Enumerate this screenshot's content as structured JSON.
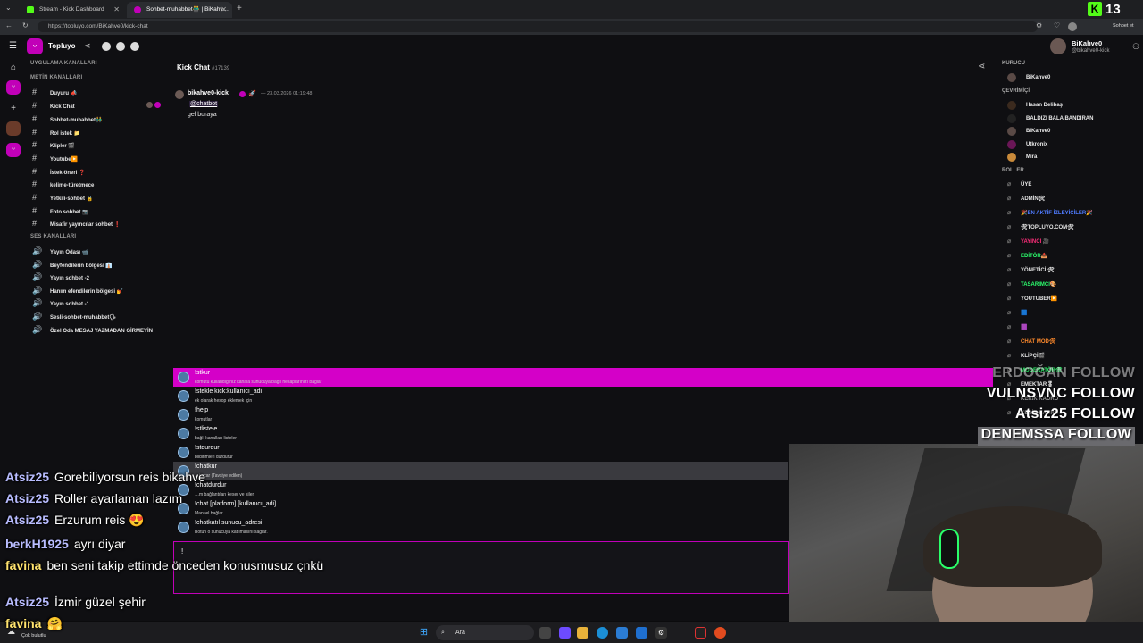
{
  "browser": {
    "tabs": [
      {
        "label": "Stream - Kick Dashboard",
        "active": false
      },
      {
        "label": "Sohbet-muhabbet👬 | BiKahv…",
        "active": true
      }
    ],
    "new_tab_glyph": "+",
    "url": "https://topluyo.com/BiKahve0/kick-chat",
    "kick_counter": "13",
    "sohbet_label": "Sohbet et"
  },
  "app": {
    "brand": "Topluyo",
    "sections": {
      "app_channels": "UYGULAMA KANALLARI",
      "text_channels": "METİN KANALLARI",
      "voice_channels": "SES KANALLARI"
    },
    "text_channels": [
      "Duyuru 📣",
      "Kick Chat",
      "Sohbet-muhabbet👬",
      "Rol istek 📁",
      "Klipler 🎬",
      "Youtube▶️",
      "İstek-öneri ❓",
      "kelime-türetmece",
      "Yetkili-sohbet 🔒",
      "Foto sohbet 📷",
      "Misafir yayıncılar sohbet ❗"
    ],
    "voice_channels": [
      "Yayın Odası 📹",
      "Beyfendilerin bölgesi 👔",
      "Yayın sohbet -2",
      "Hanım efendilerin bölgesi 💅",
      "Yayın sohbet -1",
      "Sesli-sohbet-muhabbet🗣",
      "Özel Oda MESAJ YAZMADAN GİRMEYİN"
    ]
  },
  "chat": {
    "title": "Kick Chat",
    "id": "#17139",
    "message": {
      "author": "bikahve0-kick",
      "time": "— 23.03.2026 01:19:48",
      "mention": "@chatbot",
      "text": "gel buraya"
    },
    "commands": [
      {
        "name": "!stkur",
        "desc": "komutu kullandığınız kanala sunucuya bağlı hesaplarınızı bağlar"
      },
      {
        "name": "!stekle kick:kullanıcı_adi",
        "desc": "ek olarak hesop eklemek için"
      },
      {
        "name": "!help",
        "desc": "komutlar"
      },
      {
        "name": "!stlistele",
        "desc": "bağlı kanalları listeler"
      },
      {
        "name": "!stdurdur",
        "desc": "bildirimleri durdurur"
      },
      {
        "name": "!chatkur",
        "desc": "…i açar (Tavsiye edilen)"
      },
      {
        "name": "!chatdurdur",
        "desc": "…m bağlantıları keser ve siler."
      },
      {
        "name": "!chat [platform] [kullanıcı_adi]",
        "desc": "Manuel bağlar."
      },
      {
        "name": "!chatkatıl sunucu_adresi",
        "desc": "Botun o sunucuya katılmasını sağlar."
      }
    ],
    "input_value": "!"
  },
  "members": {
    "user": {
      "name": "BiKahve0",
      "handle": "@bikahve0-kick"
    },
    "founder_heading": "KURUCU",
    "founder": "BiKahve0",
    "online_heading": "ÇEVRİMİÇİ",
    "online": [
      "Hasan Delibaş",
      "BALDIZI BALA BANDIRAN",
      "BiKahve0",
      "Utkronix",
      "Mira"
    ],
    "roles_heading": "ROLLER",
    "roles": [
      {
        "name": "ÜYE",
        "color": "#e6e6e6"
      },
      {
        "name": "ADMİN🛠",
        "color": "#e6e6e6"
      },
      {
        "name": "🎉EN AKTİF İZLEYİCİLER🎉",
        "color": "#4f7bff"
      },
      {
        "name": "🛠TOPLUYO.COM🛠",
        "color": "#e6e6e6"
      },
      {
        "name": "YAYINCI 🎥",
        "color": "#ff2d7a"
      },
      {
        "name": "EDİTÖR📤",
        "color": "#2cff6d"
      },
      {
        "name": "YÖNETİCİ 🛠",
        "color": "#e6e6e6"
      },
      {
        "name": "TASARIMCI🎨",
        "color": "#2cff6d"
      },
      {
        "name": "YOUTUBER▶️",
        "color": "#e6e6e6"
      },
      {
        "name": "🟦",
        "color": "#4f7bff"
      },
      {
        "name": "🟪",
        "color": "#ff4fd8"
      },
      {
        "name": "CHAT MOD🛠",
        "color": "#ff8a2c"
      },
      {
        "name": "KLİPÇİ🎬",
        "color": "#e6e6e6"
      },
      {
        "name": "MODERATÖR🛠",
        "color": "#2cff6d"
      },
      {
        "name": "EMEKTAR🎖",
        "color": "#e6e6e6"
      },
      {
        "name": "KERİK KADRO",
        "color": "#a0a0a0"
      },
      {
        "name": "KERİK KADRO",
        "color": "#a0a0a0"
      }
    ]
  },
  "overlay": {
    "chat": [
      {
        "user": "Atsiz25",
        "text": "Gorebiliyorsun reis bikahve"
      },
      {
        "user": "Atsiz25",
        "text": "Roller ayarlaman lazım"
      },
      {
        "user": "Atsiz25",
        "text": "Erzurum reis 😍"
      },
      {
        "user": "berkH1925",
        "text": "ayrı diyar"
      },
      {
        "user": "favina",
        "text": "ben seni takip ettimde önceden konusmusuz çnkü"
      },
      {
        "user": "Atsiz25",
        "text": "İzmir güzel şehir"
      },
      {
        "user": "favina",
        "text": "🤗"
      }
    ],
    "follows": [
      {
        "text": "ERDOĞAN FOLLOW",
        "faded": true
      },
      {
        "text": "VULNSVNC FOLLOW",
        "faded": false
      },
      {
        "text": "Atsiz25 FOLLOW",
        "faded": false
      },
      {
        "text": "DENEMSSA FOLLOW",
        "faded": false
      }
    ]
  },
  "taskbar": {
    "search_placeholder": "Ara",
    "weather": "Çok bulutlu"
  },
  "colors": {
    "accent": "#c100b8",
    "selected_command": "#d400c8"
  }
}
